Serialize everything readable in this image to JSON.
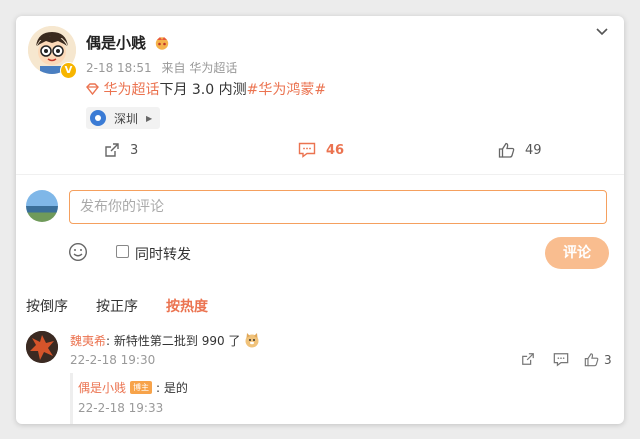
{
  "post": {
    "username": "偶是小贱",
    "time": "2-18 18:51",
    "source_prefix": "来自",
    "source": "华为超话",
    "content": {
      "supertopic": "华为超话",
      "middle": "下月 3.0 内测",
      "hashtag": "#华为鸿蒙#"
    },
    "location": "深圳",
    "actions": {
      "repost": "3",
      "comments": "46",
      "likes": "49"
    }
  },
  "compose": {
    "placeholder": "发布你的评论",
    "repost_label": "同时转发",
    "submit": "评论"
  },
  "sort_tabs": [
    "按倒序",
    "按正序",
    "按热度"
  ],
  "comment": {
    "username": "魏夷希",
    "text": ": 新特性第二批到 990 了",
    "time": "22-2-18 19:30",
    "like_count": "3"
  },
  "reply": {
    "username": "偶是小贱",
    "badge": "博主",
    "text": ": 是的",
    "time": "22-2-18 19:33"
  },
  "colors": {
    "accent": "#eb7350",
    "button": "#f9bd8f",
    "link_blue": "#3a7bd5"
  },
  "icons": [
    "chevron-down-icon",
    "verified-icon",
    "supertopic-icon",
    "location-pin-icon",
    "repost-icon",
    "comment-icon",
    "like-icon",
    "emoji-icon"
  ]
}
